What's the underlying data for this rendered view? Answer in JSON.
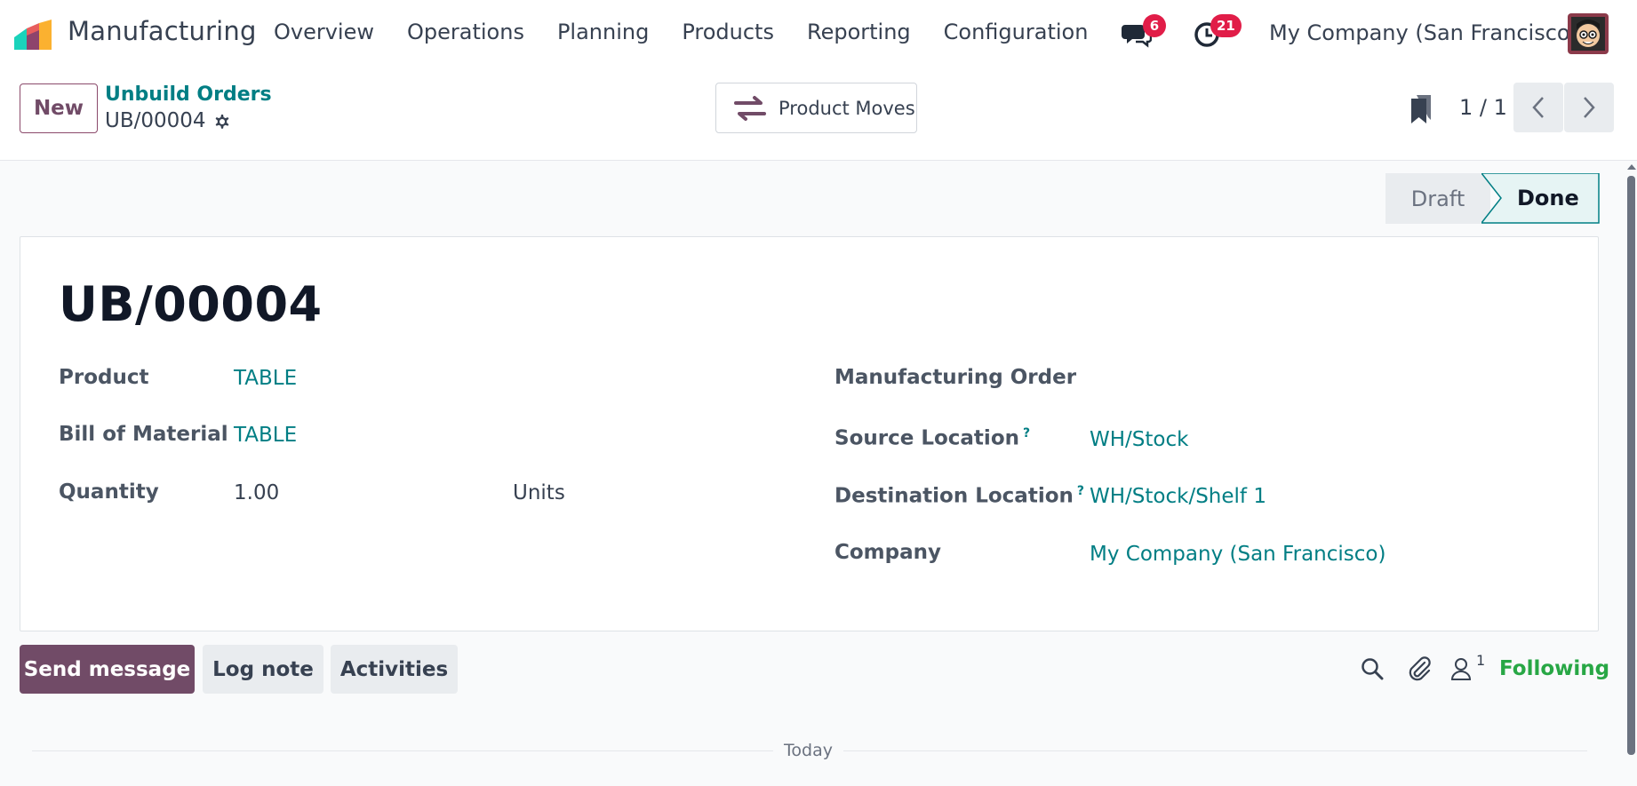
{
  "navbar": {
    "app_name": "Manufacturing",
    "menu": [
      "Overview",
      "Operations",
      "Planning",
      "Products",
      "Reporting",
      "Configuration"
    ],
    "messages_badge": "6",
    "activities_badge": "21",
    "company": "My Company (San Francisco)"
  },
  "control_panel": {
    "new_label": "New",
    "breadcrumb_parent": "Unbuild Orders",
    "breadcrumb_current": "UB/00004",
    "product_moves_label": "Product Moves",
    "pager": "1 / 1"
  },
  "statusbar": {
    "draft_label": "Draft",
    "done_label": "Done",
    "active": "Done"
  },
  "form": {
    "title": "UB/00004",
    "product_label": "Product",
    "product_value": "TABLE",
    "bom_label": "Bill of Material",
    "bom_value": "TABLE",
    "quantity_label": "Quantity",
    "quantity_value": "1.00",
    "uom_value": "Units",
    "mo_label": "Manufacturing Order",
    "source_label": "Source Location",
    "source_value": "WH/Stock",
    "dest_label": "Destination Location",
    "dest_value": "WH/Stock/Shelf 1",
    "company_label": "Company",
    "company_value": "My Company (San Francisco)",
    "help_mark": "?"
  },
  "chatter": {
    "send_message_label": "Send message",
    "log_note_label": "Log note",
    "activities_label": "Activities",
    "follower_count": "1",
    "following_label": "Following",
    "today_label": "Today"
  },
  "colors": {
    "brand": "#714b67",
    "link": "#017e84",
    "badge": "#e11d48",
    "following": "#28a745"
  },
  "icons": [
    "chat-icon",
    "clock-icon",
    "gear-icon",
    "product-moves-icon",
    "bookmark-icon",
    "chevron-left-icon",
    "chevron-right-icon",
    "search-icon",
    "paperclip-icon",
    "user-icon"
  ]
}
